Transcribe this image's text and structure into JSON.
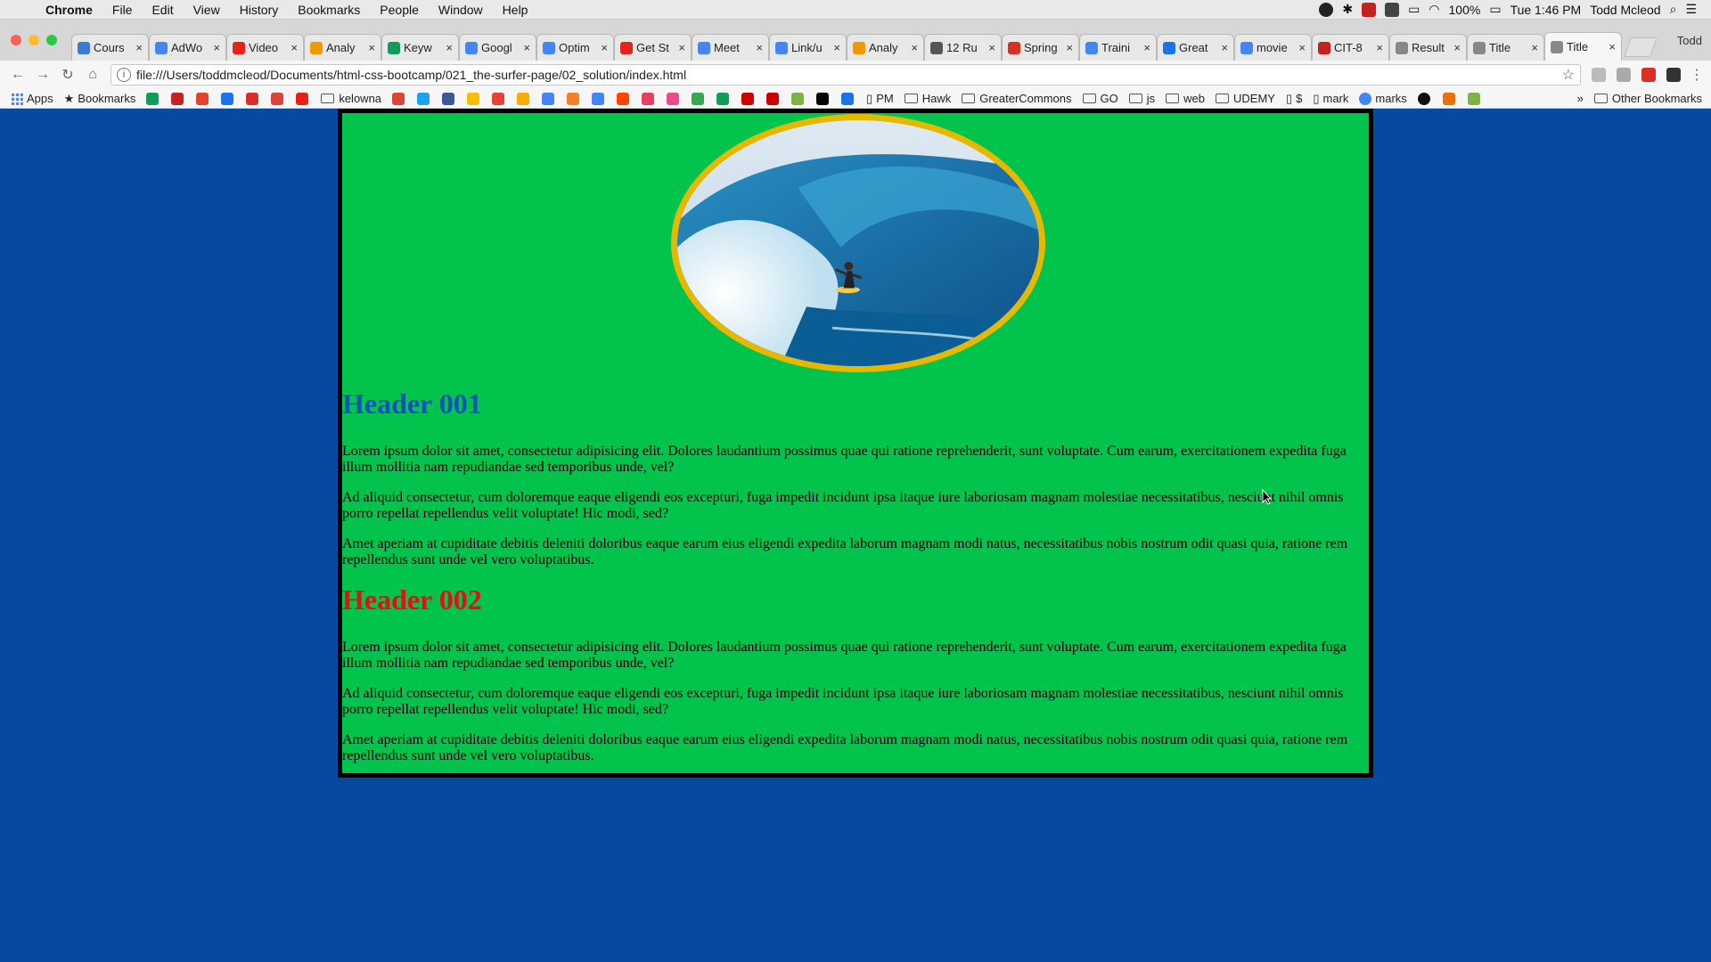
{
  "menubar": {
    "items": [
      "Chrome",
      "File",
      "Edit",
      "View",
      "History",
      "Bookmarks",
      "People",
      "Window",
      "Help"
    ],
    "battery": "100%",
    "clock": "Tue 1:46 PM",
    "user": "Todd Mcleod"
  },
  "tabs": [
    {
      "title": "Cours",
      "color": "#3a7bd5"
    },
    {
      "title": "AdWo",
      "color": "#4285f4"
    },
    {
      "title": "Video",
      "color": "#e62117"
    },
    {
      "title": "Analy",
      "color": "#f29900"
    },
    {
      "title": "Keyw",
      "color": "#0f9d58"
    },
    {
      "title": "Googl",
      "color": "#4285f4"
    },
    {
      "title": "Optim",
      "color": "#4285f4"
    },
    {
      "title": "Get St",
      "color": "#e62117"
    },
    {
      "title": "Meet",
      "color": "#4285f4"
    },
    {
      "title": "Link/u",
      "color": "#4285f4"
    },
    {
      "title": "Analy",
      "color": "#f29900"
    },
    {
      "title": "12 Ru",
      "color": "#555555"
    },
    {
      "title": "Spring",
      "color": "#d93025"
    },
    {
      "title": "Traini",
      "color": "#4285f4"
    },
    {
      "title": "Great",
      "color": "#1a73e8"
    },
    {
      "title": "movie",
      "color": "#4285f4"
    },
    {
      "title": "CIT-8",
      "color": "#c5221f"
    },
    {
      "title": "Result",
      "color": "#888888"
    },
    {
      "title": "Title",
      "color": "#888888"
    },
    {
      "title": "Title",
      "color": "#888888",
      "active": true
    }
  ],
  "profile": "Todd",
  "toolbar": {
    "url": "file:///Users/toddmcleod/Documents/html-css-bootcamp/021_the-surfer-page/02_solution/index.html"
  },
  "bookmarks": {
    "apps": "Apps",
    "bookmarks": "Bookmarks",
    "kelowna": "kelowna",
    "pm": "PM",
    "hawk": "Hawk",
    "greatercommons": "GreaterCommons",
    "go": "GO",
    "js": "js",
    "web": "web",
    "udemy": "UDEMY",
    "dollar": "$",
    "mark": "mark",
    "marks": "marks",
    "other": "Other Bookmarks",
    "colors": [
      "#0f9d58",
      "#c5221f",
      "#e24329",
      "#1a73e8",
      "#d93025",
      "#db4437",
      "#e62117"
    ],
    "colors2": [
      "#db4437",
      "#1da1f2",
      "#3b5998",
      "#fbbc04",
      "#e94235",
      "#f9ab00",
      "#4285f4",
      "#f48024",
      "#4285f4",
      "#ff4500",
      "#e4405f",
      "#ea4c89",
      "#34a853",
      "#0f9d58",
      "#cc0000",
      "#cc0000",
      "#7cb342",
      "#000000",
      "#1a73e8"
    ]
  },
  "page": {
    "header1": "Header 001",
    "header2": "Header 002",
    "p1": "Lorem ipsum dolor sit amet, consectetur adipisicing elit. Dolores laudantium possimus quae qui ratione reprehenderit, sunt voluptate. Cum earum, exercitationem expedita fuga illum mollitia nam repudiandae sed temporibus unde, vel?",
    "p2": "Ad aliquid consectetur, cum doloremque eaque eligendi eos excepturi, fuga impedit incidunt ipsa itaque iure laboriosam magnam molestiae necessitatibus, nesciunt nihil omnis porro repellat repellendus velit voluptate! Hic modi, sed?",
    "p3": "Amet aperiam at cupiditate debitis deleniti doloribus eaque earum eius eligendi expedita laborum magnam modi natus, necessitatibus nobis nostrum odit quasi quia, ratione rem repellendus sunt unde vel vero voluptatibus.",
    "p4": "Lorem ipsum dolor sit amet, consectetur adipisicing elit. Dolores laudantium possimus quae qui ratione reprehenderit, sunt voluptate. Cum earum, exercitationem expedita fuga illum mollitia nam repudiandae sed temporibus unde, vel?",
    "p5": "Ad aliquid consectetur, cum doloremque eaque eligendi eos excepturi, fuga impedit incidunt ipsa itaque iure laboriosam magnam molestiae necessitatibus, nesciunt nihil omnis porro repellat repellendus velit voluptate! Hic modi, sed?",
    "p6": "Amet aperiam at cupiditate debitis deleniti doloribus eaque earum eius eligendi expedita laborum magnam modi natus, necessitatibus nobis nostrum odit quasi quia, ratione rem repellendus sunt unde vel vero voluptatibus."
  },
  "colors": {
    "page_bg": "#054aa0",
    "container_bg": "#02c44c",
    "header1": "#0f53b8",
    "header2": "#e21010",
    "hero_border": "#e6b800"
  }
}
